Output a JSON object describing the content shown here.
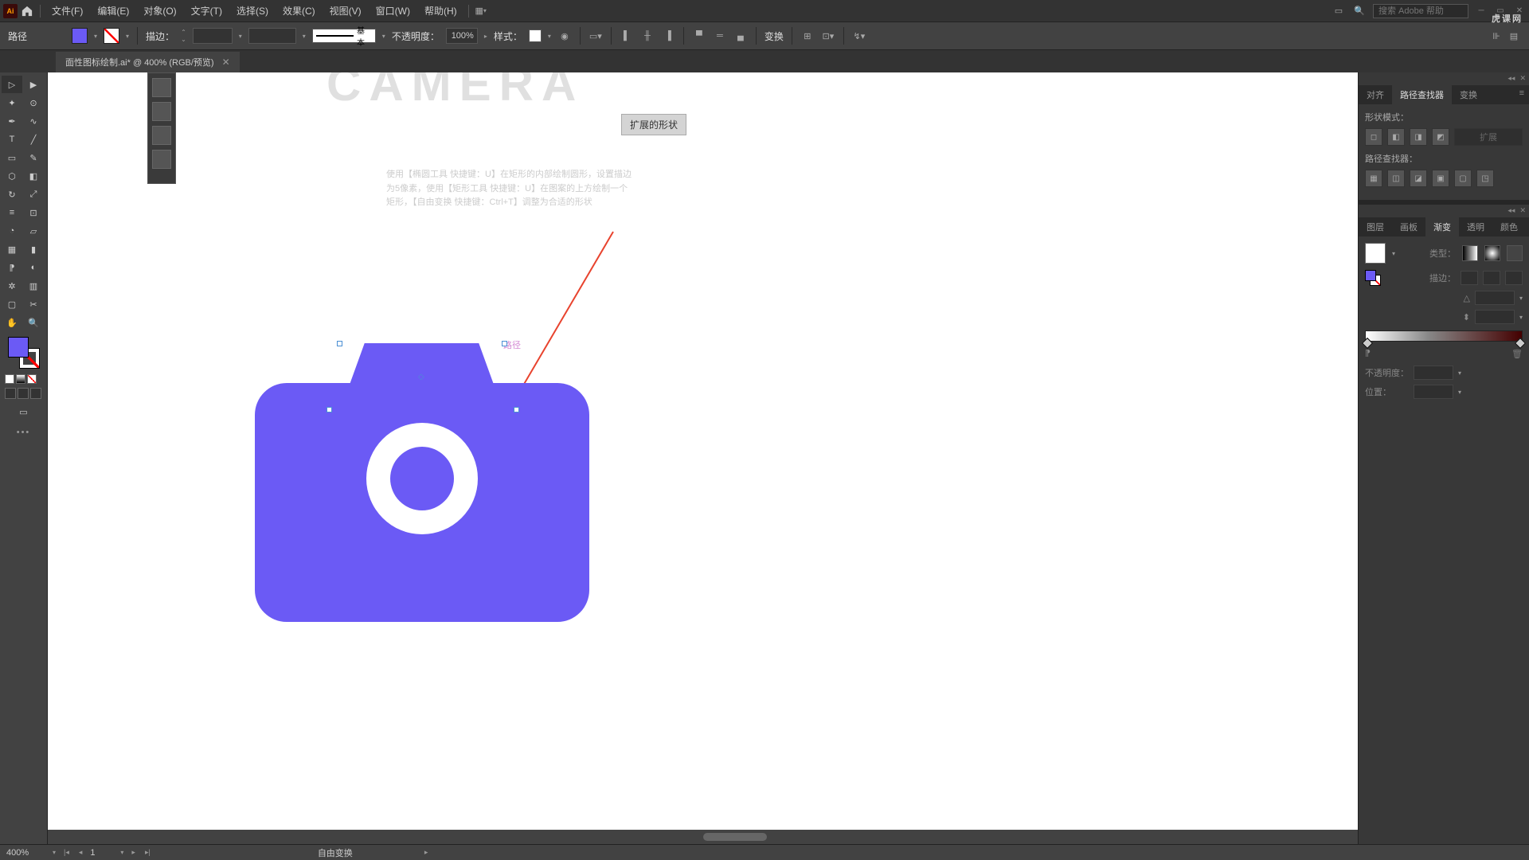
{
  "menubar": {
    "logo": "Ai",
    "items": [
      "文件(F)",
      "编辑(E)",
      "对象(O)",
      "文字(T)",
      "选择(S)",
      "效果(C)",
      "视图(V)",
      "窗口(W)",
      "帮助(H)"
    ],
    "search_placeholder": "搜索 Adobe 帮助"
  },
  "controlbar": {
    "path_label": "路径",
    "stroke_label": "描边：",
    "stroke_weight": "",
    "brush_label": "基本",
    "opacity_label": "不透明度：",
    "opacity_value": "100%",
    "style_label": "样式：",
    "transform_label": "变换"
  },
  "document": {
    "tab_title": "面性图标绘制.ai* @ 400% (RGB/预览)"
  },
  "canvas": {
    "camera_text": "CAMERA",
    "expand_btn": "扩展的形状",
    "instruction_line1": "使用【椭圆工具 快捷键：U】在矩形的内部绘制圆形，设置描边",
    "instruction_line2": "为5像素，使用【矩形工具 快捷键：U】在图案的上方绘制一个",
    "instruction_line3": "矩形，【自由变换 快捷键：Ctrl+T】调整为合适的形状",
    "path_label": "路径"
  },
  "panels": {
    "align_tabs": [
      "对齐",
      "路径查找器",
      "变换"
    ],
    "shape_mode_label": "形状模式：",
    "pathfinder_label": "路径查找器：",
    "expand_label": "扩展",
    "swatch_tabs": [
      "图层",
      "画板",
      "渐变",
      "透明",
      "颜色"
    ],
    "gradient": {
      "type_label": "类型：",
      "stroke_label": "描边：",
      "opacity_label": "不透明度：",
      "location_label": "位置："
    }
  },
  "statusbar": {
    "zoom": "400%",
    "artboard": "1",
    "tool": "自由变换"
  },
  "watermark": "虎课网"
}
